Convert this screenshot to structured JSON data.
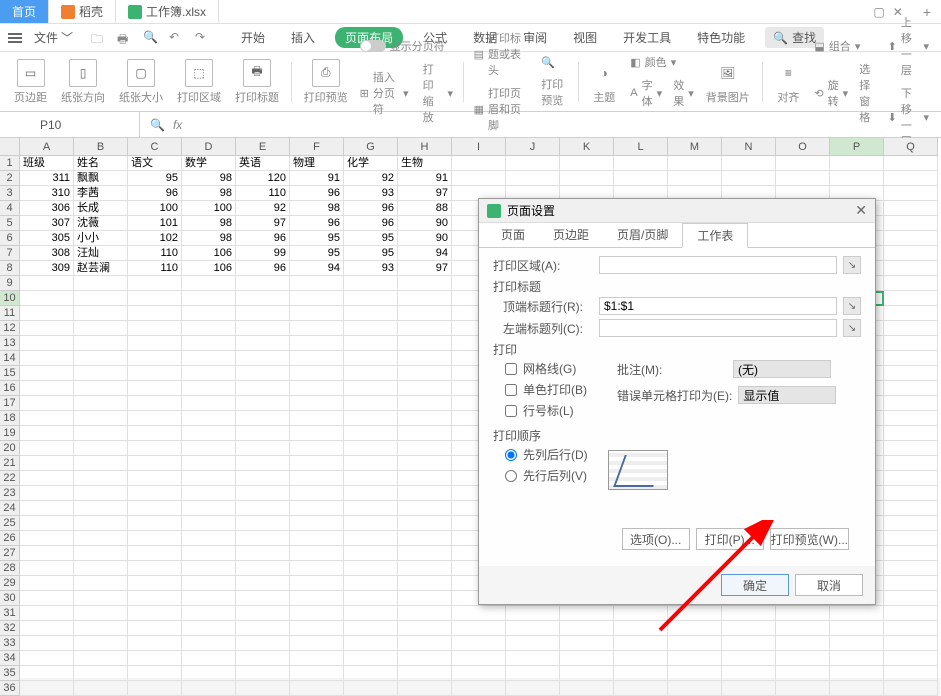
{
  "title_tabs": {
    "home": "首页",
    "doc": "稻壳",
    "sheet": "工作簿.xlsx"
  },
  "file_menu": "文件",
  "ribbon": {
    "tabs": [
      "开始",
      "插入",
      "页面布局",
      "公式",
      "数据",
      "审阅",
      "视图",
      "开发工具",
      "特色功能"
    ],
    "search": "查找"
  },
  "toolbar": {
    "margins": "页边距",
    "orient": "纸张方向",
    "size": "纸张大小",
    "area": "打印区域",
    "titles": "打印标题",
    "show_page": "显示分页符",
    "breaks": "插入分页符",
    "scale": "打印缩放",
    "header": "打印标题或表头",
    "page_hf": "打印页眉和页脚",
    "preview": "打印预览",
    "theme": "主题",
    "colors": "颜色",
    "fonts": "字体",
    "effects": "效果",
    "bg": "背景图片",
    "align": "对齐",
    "rotate": "旋转",
    "pane": "选择窗格",
    "combine": "组合",
    "up": "上移一层",
    "down": "下移一层"
  },
  "name_box": "P10",
  "columns": [
    "A",
    "B",
    "C",
    "D",
    "E",
    "F",
    "G",
    "H",
    "I",
    "J",
    "K",
    "L",
    "M",
    "N",
    "O",
    "P",
    "Q"
  ],
  "headers": [
    "班级",
    "姓名",
    "语文",
    "数学",
    "英语",
    "物理",
    "化学",
    "生物"
  ],
  "rows": [
    [
      311,
      "飘飘",
      95,
      98,
      120,
      91,
      92,
      91
    ],
    [
      310,
      "李茜",
      96,
      98,
      110,
      96,
      93,
      97
    ],
    [
      306,
      "长成",
      100,
      100,
      92,
      98,
      96,
      88
    ],
    [
      307,
      "沈薇",
      101,
      98,
      97,
      96,
      96,
      90
    ],
    [
      305,
      "小小",
      102,
      98,
      96,
      95,
      95,
      90
    ],
    [
      308,
      "汪灿",
      110,
      106,
      99,
      95,
      95,
      94
    ],
    [
      309,
      "赵芸澜",
      110,
      106,
      96,
      94,
      93,
      97
    ]
  ],
  "dialog": {
    "title": "页面设置",
    "tabs": [
      "页面",
      "页边距",
      "页眉/页脚",
      "工作表"
    ],
    "print_area": "打印区域(A):",
    "print_titles": "打印标题",
    "top_row": "顶端标题行(R):",
    "top_row_val": "$1:$1",
    "left_col": "左端标题列(C):",
    "print": "打印",
    "gridlines": "网格线(G)",
    "bw": "单色打印(B)",
    "rowcol": "行号标(L)",
    "comments": "批注(M):",
    "comments_val": "(无)",
    "errors": "错误单元格打印为(E):",
    "errors_val": "显示值",
    "order": "打印顺序",
    "down_over": "先列后行(D)",
    "over_down": "先行后列(V)",
    "btn_options": "选项(O)...",
    "btn_print": "打印(P)...",
    "btn_preview": "打印预览(W)...",
    "ok": "确定",
    "cancel": "取消"
  }
}
